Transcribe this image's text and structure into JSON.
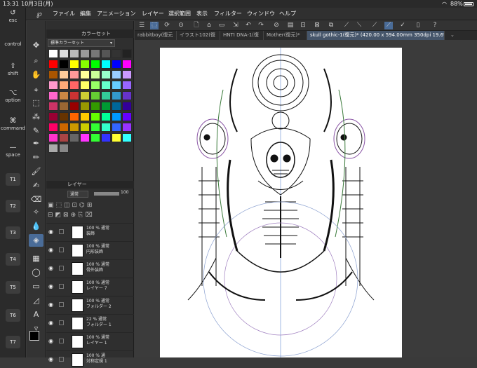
{
  "status": {
    "time": "13:31",
    "date": "10月3日(月)",
    "battery": "88%"
  },
  "menu": [
    "ファイル",
    "編集",
    "アニメーション",
    "レイヤー",
    "選択範囲",
    "表示",
    "フィルター",
    "ウィンドウ",
    "ヘルプ"
  ],
  "modifiers": [
    {
      "glyph": "↺",
      "label": "esc"
    },
    {
      "glyph": "",
      "label": "control"
    },
    {
      "glyph": "⇧",
      "label": "shift"
    },
    {
      "glyph": "⌥",
      "label": "option"
    },
    {
      "glyph": "⌘",
      "label": "command"
    },
    {
      "glyph": "—",
      "label": "space"
    }
  ],
  "tkeys": [
    "T1",
    "T2",
    "T3",
    "T4",
    "T5",
    "T6",
    "T7"
  ],
  "palette": {
    "title": "カラーセット",
    "set_name": "標準カラーセット"
  },
  "tabs": [
    "rabbitboy(復元",
    "イラスト102(復",
    "HNTI DNA-1(復",
    "Mother(復元)*",
    "skull gothic-1(復元)* (420.00 x 594.00mm 350dpi 19.6%)"
  ],
  "layers": {
    "title": "レイヤー",
    "blend": "通常",
    "opacity": "100",
    "rows": [
      {
        "pct": "100 % 通常",
        "name": "装飾"
      },
      {
        "pct": "100 % 通常",
        "name": "円形装飾"
      },
      {
        "pct": "100 % 通常",
        "name": "骨外装飾"
      },
      {
        "pct": "100 % 通常",
        "name": "レイヤー 7"
      },
      {
        "pct": "100 % 通常",
        "name": "フォルダー 2"
      },
      {
        "pct": "22 % 通常",
        "name": "フォルダー 1"
      },
      {
        "pct": "100 % 通常",
        "name": "レイヤー 1"
      },
      {
        "pct": "100 % 通",
        "name": "対称定規 1"
      }
    ]
  },
  "colors": {
    "accent": "#4a90d9",
    "bg": "#3a3a3a",
    "panel": "#2f2f2f"
  }
}
